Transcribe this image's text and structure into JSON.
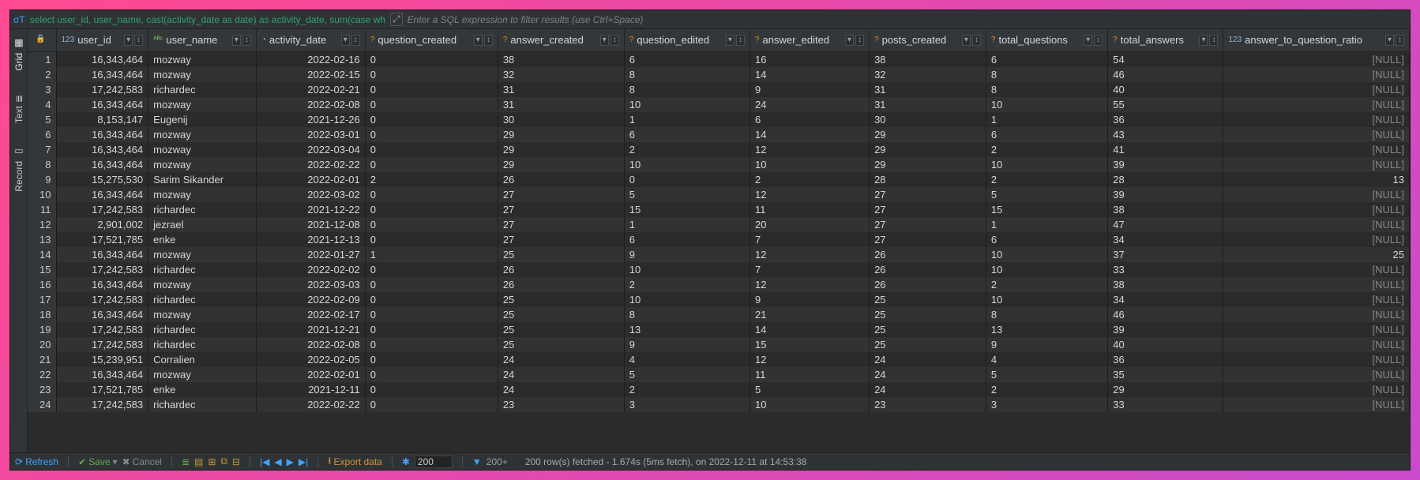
{
  "topbar": {
    "sql_preview": "select user_id, user_name, cast(activity_date as date) as activity_date, sum(case wh",
    "filter_placeholder": "Enter a SQL expression to filter results (use Ctrl+Space)"
  },
  "sidebar": {
    "tabs": [
      {
        "label": "Grid",
        "icon": "▦",
        "active": true
      },
      {
        "label": "Text",
        "icon": "≣",
        "active": false
      },
      {
        "label": "Record",
        "icon": "▭",
        "active": false
      }
    ]
  },
  "columns": [
    {
      "key": "user_id",
      "label": "user_id",
      "type": "123",
      "align": "right"
    },
    {
      "key": "user_name",
      "label": "user_name",
      "type": "ABC",
      "align": "left"
    },
    {
      "key": "activity_date",
      "label": "activity_date",
      "type": "clock",
      "align": "right"
    },
    {
      "key": "question_created",
      "label": "question_created",
      "type": "q",
      "align": "left"
    },
    {
      "key": "answer_created",
      "label": "answer_created",
      "type": "q",
      "align": "left"
    },
    {
      "key": "question_edited",
      "label": "question_edited",
      "type": "q",
      "align": "left"
    },
    {
      "key": "answer_edited",
      "label": "answer_edited",
      "type": "q",
      "align": "left"
    },
    {
      "key": "posts_created",
      "label": "posts_created",
      "type": "q",
      "align": "left"
    },
    {
      "key": "total_questions",
      "label": "total_questions",
      "type": "q",
      "align": "left"
    },
    {
      "key": "total_answers",
      "label": "total_answers",
      "type": "q",
      "align": "left"
    },
    {
      "key": "answer_to_question_ratio",
      "label": "answer_to_question_ratio",
      "type": "123",
      "align": "right"
    }
  ],
  "type_glyph": {
    "123": "123",
    "ABC": "ᴬᴮᶜ",
    "clock": "◔",
    "q": "?"
  },
  "filter_glyph": "▾",
  "sort_glyph": "↕",
  "lock_glyph": "🔒",
  "null_text": "[NULL]",
  "rows": [
    {
      "user_id": "16,343,464",
      "user_name": "mozway",
      "activity_date": "2022-02-16",
      "question_created": "0",
      "answer_created": "38",
      "question_edited": "6",
      "answer_edited": "16",
      "posts_created": "38",
      "total_questions": "6",
      "total_answers": "54",
      "answer_to_question_ratio": null
    },
    {
      "user_id": "16,343,464",
      "user_name": "mozway",
      "activity_date": "2022-02-15",
      "question_created": "0",
      "answer_created": "32",
      "question_edited": "8",
      "answer_edited": "14",
      "posts_created": "32",
      "total_questions": "8",
      "total_answers": "46",
      "answer_to_question_ratio": null
    },
    {
      "user_id": "17,242,583",
      "user_name": "richardec",
      "activity_date": "2022-02-21",
      "question_created": "0",
      "answer_created": "31",
      "question_edited": "8",
      "answer_edited": "9",
      "posts_created": "31",
      "total_questions": "8",
      "total_answers": "40",
      "answer_to_question_ratio": null
    },
    {
      "user_id": "16,343,464",
      "user_name": "mozway",
      "activity_date": "2022-02-08",
      "question_created": "0",
      "answer_created": "31",
      "question_edited": "10",
      "answer_edited": "24",
      "posts_created": "31",
      "total_questions": "10",
      "total_answers": "55",
      "answer_to_question_ratio": null
    },
    {
      "user_id": "8,153,147",
      "user_name": "Eugenij",
      "activity_date": "2021-12-26",
      "question_created": "0",
      "answer_created": "30",
      "question_edited": "1",
      "answer_edited": "6",
      "posts_created": "30",
      "total_questions": "1",
      "total_answers": "36",
      "answer_to_question_ratio": null
    },
    {
      "user_id": "16,343,464",
      "user_name": "mozway",
      "activity_date": "2022-03-01",
      "question_created": "0",
      "answer_created": "29",
      "question_edited": "6",
      "answer_edited": "14",
      "posts_created": "29",
      "total_questions": "6",
      "total_answers": "43",
      "answer_to_question_ratio": null
    },
    {
      "user_id": "16,343,464",
      "user_name": "mozway",
      "activity_date": "2022-03-04",
      "question_created": "0",
      "answer_created": "29",
      "question_edited": "2",
      "answer_edited": "12",
      "posts_created": "29",
      "total_questions": "2",
      "total_answers": "41",
      "answer_to_question_ratio": null
    },
    {
      "user_id": "16,343,464",
      "user_name": "mozway",
      "activity_date": "2022-02-22",
      "question_created": "0",
      "answer_created": "29",
      "question_edited": "10",
      "answer_edited": "10",
      "posts_created": "29",
      "total_questions": "10",
      "total_answers": "39",
      "answer_to_question_ratio": null
    },
    {
      "user_id": "15,275,530",
      "user_name": "Sarim Sikander",
      "activity_date": "2022-02-01",
      "question_created": "2",
      "answer_created": "26",
      "question_edited": "0",
      "answer_edited": "2",
      "posts_created": "28",
      "total_questions": "2",
      "total_answers": "28",
      "answer_to_question_ratio": "13"
    },
    {
      "user_id": "16,343,464",
      "user_name": "mozway",
      "activity_date": "2022-03-02",
      "question_created": "0",
      "answer_created": "27",
      "question_edited": "5",
      "answer_edited": "12",
      "posts_created": "27",
      "total_questions": "5",
      "total_answers": "39",
      "answer_to_question_ratio": null
    },
    {
      "user_id": "17,242,583",
      "user_name": "richardec",
      "activity_date": "2021-12-22",
      "question_created": "0",
      "answer_created": "27",
      "question_edited": "15",
      "answer_edited": "11",
      "posts_created": "27",
      "total_questions": "15",
      "total_answers": "38",
      "answer_to_question_ratio": null
    },
    {
      "user_id": "2,901,002",
      "user_name": "jezrael",
      "activity_date": "2021-12-08",
      "question_created": "0",
      "answer_created": "27",
      "question_edited": "1",
      "answer_edited": "20",
      "posts_created": "27",
      "total_questions": "1",
      "total_answers": "47",
      "answer_to_question_ratio": null
    },
    {
      "user_id": "17,521,785",
      "user_name": "enke",
      "activity_date": "2021-12-13",
      "question_created": "0",
      "answer_created": "27",
      "question_edited": "6",
      "answer_edited": "7",
      "posts_created": "27",
      "total_questions": "6",
      "total_answers": "34",
      "answer_to_question_ratio": null
    },
    {
      "user_id": "16,343,464",
      "user_name": "mozway",
      "activity_date": "2022-01-27",
      "question_created": "1",
      "answer_created": "25",
      "question_edited": "9",
      "answer_edited": "12",
      "posts_created": "26",
      "total_questions": "10",
      "total_answers": "37",
      "answer_to_question_ratio": "25"
    },
    {
      "user_id": "17,242,583",
      "user_name": "richardec",
      "activity_date": "2022-02-02",
      "question_created": "0",
      "answer_created": "26",
      "question_edited": "10",
      "answer_edited": "7",
      "posts_created": "26",
      "total_questions": "10",
      "total_answers": "33",
      "answer_to_question_ratio": null
    },
    {
      "user_id": "16,343,464",
      "user_name": "mozway",
      "activity_date": "2022-03-03",
      "question_created": "0",
      "answer_created": "26",
      "question_edited": "2",
      "answer_edited": "12",
      "posts_created": "26",
      "total_questions": "2",
      "total_answers": "38",
      "answer_to_question_ratio": null
    },
    {
      "user_id": "17,242,583",
      "user_name": "richardec",
      "activity_date": "2022-02-09",
      "question_created": "0",
      "answer_created": "25",
      "question_edited": "10",
      "answer_edited": "9",
      "posts_created": "25",
      "total_questions": "10",
      "total_answers": "34",
      "answer_to_question_ratio": null
    },
    {
      "user_id": "16,343,464",
      "user_name": "mozway",
      "activity_date": "2022-02-17",
      "question_created": "0",
      "answer_created": "25",
      "question_edited": "8",
      "answer_edited": "21",
      "posts_created": "25",
      "total_questions": "8",
      "total_answers": "46",
      "answer_to_question_ratio": null
    },
    {
      "user_id": "17,242,583",
      "user_name": "richardec",
      "activity_date": "2021-12-21",
      "question_created": "0",
      "answer_created": "25",
      "question_edited": "13",
      "answer_edited": "14",
      "posts_created": "25",
      "total_questions": "13",
      "total_answers": "39",
      "answer_to_question_ratio": null
    },
    {
      "user_id": "17,242,583",
      "user_name": "richardec",
      "activity_date": "2022-02-08",
      "question_created": "0",
      "answer_created": "25",
      "question_edited": "9",
      "answer_edited": "15",
      "posts_created": "25",
      "total_questions": "9",
      "total_answers": "40",
      "answer_to_question_ratio": null
    },
    {
      "user_id": "15,239,951",
      "user_name": "Corralien",
      "activity_date": "2022-02-05",
      "question_created": "0",
      "answer_created": "24",
      "question_edited": "4",
      "answer_edited": "12",
      "posts_created": "24",
      "total_questions": "4",
      "total_answers": "36",
      "answer_to_question_ratio": null
    },
    {
      "user_id": "16,343,464",
      "user_name": "mozway",
      "activity_date": "2022-02-01",
      "question_created": "0",
      "answer_created": "24",
      "question_edited": "5",
      "answer_edited": "11",
      "posts_created": "24",
      "total_questions": "5",
      "total_answers": "35",
      "answer_to_question_ratio": null
    },
    {
      "user_id": "17,521,785",
      "user_name": "enke",
      "activity_date": "2021-12-11",
      "question_created": "0",
      "answer_created": "24",
      "question_edited": "2",
      "answer_edited": "5",
      "posts_created": "24",
      "total_questions": "2",
      "total_answers": "29",
      "answer_to_question_ratio": null
    },
    {
      "user_id": "17,242,583",
      "user_name": "richardec",
      "activity_date": "2022-02-22",
      "question_created": "0",
      "answer_created": "23",
      "question_edited": "3",
      "answer_edited": "10",
      "posts_created": "23",
      "total_questions": "3",
      "total_answers": "33",
      "answer_to_question_ratio": null
    }
  ],
  "statusbar": {
    "refresh": "Refresh",
    "save": "Save",
    "cancel": "Cancel",
    "export": "Export data",
    "row_count": "200",
    "row_count_opt": "200+",
    "status": "200 row(s) fetched - 1.674s (5ms fetch), on 2022-12-11 at 14:53:38"
  }
}
